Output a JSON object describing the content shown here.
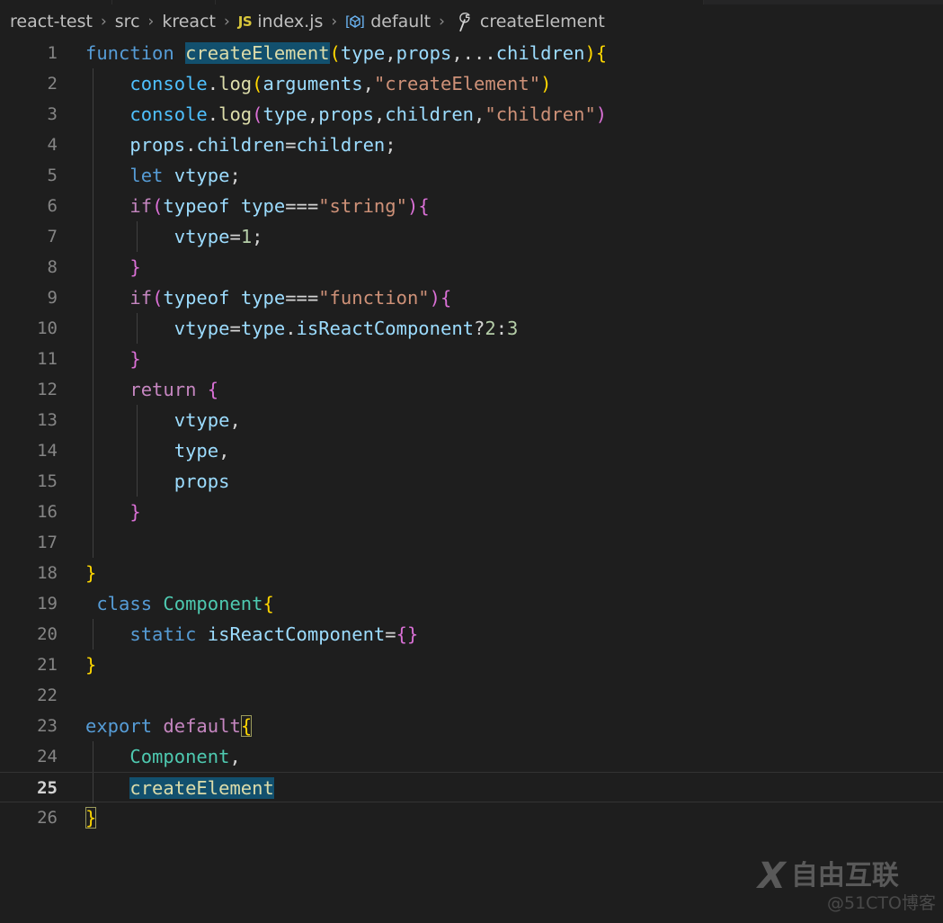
{
  "window": {
    "app": "Visual Studio Code",
    "theme_bg": "#1e1e1e",
    "accent_selection": "#12506e"
  },
  "breadcrumbs": {
    "name": "breadcrumb",
    "separator": "›",
    "items": [
      {
        "label": "react-test",
        "icon": null
      },
      {
        "label": "src",
        "icon": null
      },
      {
        "label": "kreact",
        "icon": null
      },
      {
        "label": "index.js",
        "icon": "js-file-icon",
        "icon_text": "JS"
      },
      {
        "label": "default",
        "icon": "module-symbol-icon",
        "icon_text": "⬢"
      },
      {
        "label": "createElement",
        "icon": "wrench-method-icon",
        "icon_text": "wrench"
      }
    ]
  },
  "editor": {
    "language": "javascript",
    "active_line": 25,
    "selection_text": "createElement",
    "lines": [
      {
        "n": 1,
        "indent": 0,
        "tokens": [
          {
            "t": "function",
            "c": "t-kw"
          },
          {
            "t": " ",
            "c": "t-punct"
          },
          {
            "t": "createElement",
            "c": "t-fn sel"
          },
          {
            "t": "(",
            "c": "t-yel"
          },
          {
            "t": "type",
            "c": "t-var"
          },
          {
            "t": ",",
            "c": "t-punct"
          },
          {
            "t": "props",
            "c": "t-var"
          },
          {
            "t": ",",
            "c": "t-punct"
          },
          {
            "t": "...",
            "c": "t-punct"
          },
          {
            "t": "children",
            "c": "t-var"
          },
          {
            "t": ")",
            "c": "t-yel"
          },
          {
            "t": "{",
            "c": "t-yel"
          }
        ]
      },
      {
        "n": 2,
        "indent": 1,
        "tokens": [
          {
            "t": "    ",
            "c": "t-punct"
          },
          {
            "t": "console",
            "c": "t-obj"
          },
          {
            "t": ".",
            "c": "t-punct"
          },
          {
            "t": "log",
            "c": "t-fn"
          },
          {
            "t": "(",
            "c": "t-yel"
          },
          {
            "t": "arguments",
            "c": "t-var"
          },
          {
            "t": ",",
            "c": "t-punct"
          },
          {
            "t": "\"createElement\"",
            "c": "t-str"
          },
          {
            "t": ")",
            "c": "t-yel"
          }
        ]
      },
      {
        "n": 3,
        "indent": 1,
        "tokens": [
          {
            "t": "    ",
            "c": "t-punct"
          },
          {
            "t": "console",
            "c": "t-obj"
          },
          {
            "t": ".",
            "c": "t-punct"
          },
          {
            "t": "log",
            "c": "t-fn"
          },
          {
            "t": "(",
            "c": "t-pink"
          },
          {
            "t": "type",
            "c": "t-var"
          },
          {
            "t": ",",
            "c": "t-punct"
          },
          {
            "t": "props",
            "c": "t-var"
          },
          {
            "t": ",",
            "c": "t-punct"
          },
          {
            "t": "children",
            "c": "t-var"
          },
          {
            "t": ",",
            "c": "t-punct"
          },
          {
            "t": "\"children\"",
            "c": "t-str"
          },
          {
            "t": ")",
            "c": "t-pink"
          }
        ]
      },
      {
        "n": 4,
        "indent": 1,
        "tokens": [
          {
            "t": "    ",
            "c": "t-punct"
          },
          {
            "t": "props",
            "c": "t-var"
          },
          {
            "t": ".",
            "c": "t-punct"
          },
          {
            "t": "children",
            "c": "t-var"
          },
          {
            "t": "=",
            "c": "t-punct"
          },
          {
            "t": "children",
            "c": "t-var"
          },
          {
            "t": ";",
            "c": "t-punct"
          }
        ]
      },
      {
        "n": 5,
        "indent": 1,
        "tokens": [
          {
            "t": "    ",
            "c": "t-punct"
          },
          {
            "t": "let",
            "c": "t-kw"
          },
          {
            "t": " ",
            "c": "t-punct"
          },
          {
            "t": "vtype",
            "c": "t-var"
          },
          {
            "t": ";",
            "c": "t-punct"
          }
        ]
      },
      {
        "n": 6,
        "indent": 1,
        "tokens": [
          {
            "t": "    ",
            "c": "t-punct"
          },
          {
            "t": "if",
            "c": "t-ctl"
          },
          {
            "t": "(",
            "c": "t-pink"
          },
          {
            "t": "typeof",
            "c": "t-var"
          },
          {
            "t": " ",
            "c": "t-punct"
          },
          {
            "t": "type",
            "c": "t-var"
          },
          {
            "t": "===",
            "c": "t-punct"
          },
          {
            "t": "\"string\"",
            "c": "t-str"
          },
          {
            "t": ")",
            "c": "t-pink"
          },
          {
            "t": "{",
            "c": "t-pink"
          }
        ]
      },
      {
        "n": 7,
        "indent": 2,
        "tokens": [
          {
            "t": "        ",
            "c": "t-punct"
          },
          {
            "t": "vtype",
            "c": "t-var"
          },
          {
            "t": "=",
            "c": "t-punct"
          },
          {
            "t": "1",
            "c": "t-num"
          },
          {
            "t": ";",
            "c": "t-punct"
          }
        ]
      },
      {
        "n": 8,
        "indent": 1,
        "tokens": [
          {
            "t": "    ",
            "c": "t-punct"
          },
          {
            "t": "}",
            "c": "t-pink"
          }
        ]
      },
      {
        "n": 9,
        "indent": 1,
        "tokens": [
          {
            "t": "    ",
            "c": "t-punct"
          },
          {
            "t": "if",
            "c": "t-ctl"
          },
          {
            "t": "(",
            "c": "t-pink"
          },
          {
            "t": "typeof",
            "c": "t-var"
          },
          {
            "t": " ",
            "c": "t-punct"
          },
          {
            "t": "type",
            "c": "t-var"
          },
          {
            "t": "===",
            "c": "t-punct"
          },
          {
            "t": "\"function\"",
            "c": "t-str"
          },
          {
            "t": ")",
            "c": "t-pink"
          },
          {
            "t": "{",
            "c": "t-pink"
          }
        ]
      },
      {
        "n": 10,
        "indent": 2,
        "tokens": [
          {
            "t": "        ",
            "c": "t-punct"
          },
          {
            "t": "vtype",
            "c": "t-var"
          },
          {
            "t": "=",
            "c": "t-punct"
          },
          {
            "t": "type",
            "c": "t-var"
          },
          {
            "t": ".",
            "c": "t-punct"
          },
          {
            "t": "isReactComponent",
            "c": "t-var"
          },
          {
            "t": "?",
            "c": "t-punct"
          },
          {
            "t": "2",
            "c": "t-num"
          },
          {
            "t": ":",
            "c": "t-punct"
          },
          {
            "t": "3",
            "c": "t-num"
          }
        ]
      },
      {
        "n": 11,
        "indent": 1,
        "tokens": [
          {
            "t": "    ",
            "c": "t-punct"
          },
          {
            "t": "}",
            "c": "t-pink"
          }
        ]
      },
      {
        "n": 12,
        "indent": 1,
        "tokens": [
          {
            "t": "    ",
            "c": "t-punct"
          },
          {
            "t": "return",
            "c": "t-ctl"
          },
          {
            "t": " ",
            "c": "t-punct"
          },
          {
            "t": "{",
            "c": "t-pink"
          }
        ]
      },
      {
        "n": 13,
        "indent": 2,
        "tokens": [
          {
            "t": "        ",
            "c": "t-punct"
          },
          {
            "t": "vtype",
            "c": "t-var"
          },
          {
            "t": ",",
            "c": "t-punct"
          }
        ]
      },
      {
        "n": 14,
        "indent": 2,
        "tokens": [
          {
            "t": "        ",
            "c": "t-punct"
          },
          {
            "t": "type",
            "c": "t-var"
          },
          {
            "t": ",",
            "c": "t-punct"
          }
        ]
      },
      {
        "n": 15,
        "indent": 2,
        "tokens": [
          {
            "t": "        ",
            "c": "t-punct"
          },
          {
            "t": "props",
            "c": "t-var"
          }
        ]
      },
      {
        "n": 16,
        "indent": 1,
        "tokens": [
          {
            "t": "    ",
            "c": "t-punct"
          },
          {
            "t": "}",
            "c": "t-pink"
          }
        ]
      },
      {
        "n": 17,
        "indent": 1,
        "tokens": []
      },
      {
        "n": 18,
        "indent": 0,
        "tokens": [
          {
            "t": "}",
            "c": "t-yel"
          }
        ]
      },
      {
        "n": 19,
        "indent": 0,
        "tokens": [
          {
            "t": " ",
            "c": "t-punct"
          },
          {
            "t": "class",
            "c": "t-kw"
          },
          {
            "t": " ",
            "c": "t-punct"
          },
          {
            "t": "Component",
            "c": "t-class"
          },
          {
            "t": "{",
            "c": "t-yel"
          }
        ]
      },
      {
        "n": 20,
        "indent": 1,
        "tokens": [
          {
            "t": "    ",
            "c": "t-punct"
          },
          {
            "t": "static",
            "c": "t-kw"
          },
          {
            "t": " ",
            "c": "t-punct"
          },
          {
            "t": "isReactComponent",
            "c": "t-var"
          },
          {
            "t": "=",
            "c": "t-punct"
          },
          {
            "t": "{",
            "c": "t-pink"
          },
          {
            "t": "}",
            "c": "t-pink"
          }
        ]
      },
      {
        "n": 21,
        "indent": 0,
        "tokens": [
          {
            "t": "}",
            "c": "t-yel"
          }
        ]
      },
      {
        "n": 22,
        "indent": 0,
        "tokens": []
      },
      {
        "n": 23,
        "indent": 0,
        "tokens": [
          {
            "t": "export",
            "c": "t-kw"
          },
          {
            "t": " ",
            "c": "t-punct"
          },
          {
            "t": "default",
            "c": "t-ctl"
          },
          {
            "t": "{",
            "c": "t-yel bmatch"
          }
        ]
      },
      {
        "n": 24,
        "indent": 1,
        "tokens": [
          {
            "t": "    ",
            "c": "t-punct"
          },
          {
            "t": "Component",
            "c": "t-class"
          },
          {
            "t": ",",
            "c": "t-punct"
          }
        ]
      },
      {
        "n": 25,
        "indent": 1,
        "active": true,
        "tokens": [
          {
            "t": "    ",
            "c": "t-punct"
          },
          {
            "t": "createElement",
            "c": "t-fn sel"
          }
        ]
      },
      {
        "n": 26,
        "indent": 0,
        "tokens": [
          {
            "t": "}",
            "c": "t-yel bmatch"
          }
        ]
      }
    ]
  },
  "watermark": {
    "name": "site-watermark",
    "mark": "X",
    "brand": "自由互联",
    "credit": "@51CTO博客"
  }
}
